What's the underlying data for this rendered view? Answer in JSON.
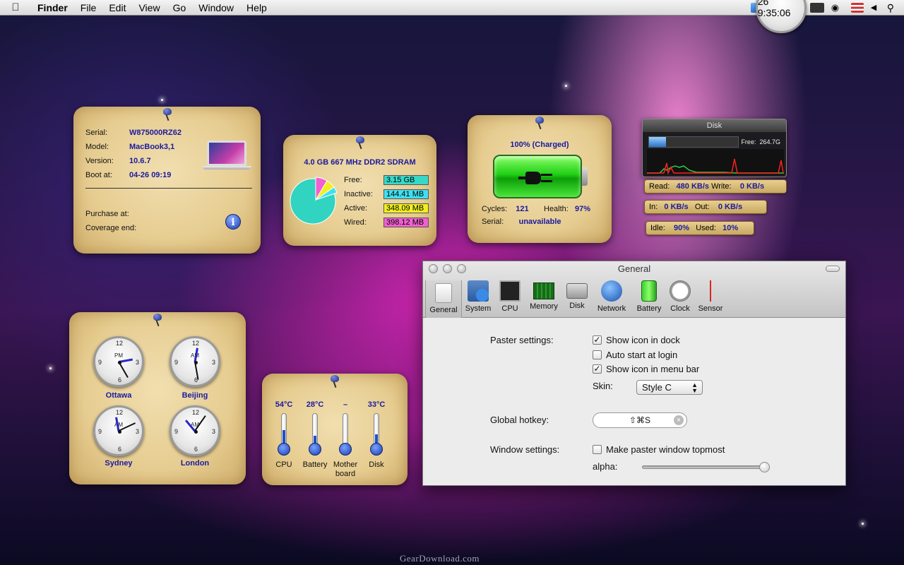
{
  "menubar": {
    "app_name": "Finder",
    "items": [
      "File",
      "Edit",
      "View",
      "Go",
      "Window",
      "Help"
    ],
    "clock": "Tue Apr 26  9:35:06"
  },
  "system_info": {
    "serial_label": "Serial:",
    "serial": "W875000RZ62",
    "model_label": "Model:",
    "model": "MacBook3,1",
    "version_label": "Version:",
    "version": "10.6.7",
    "boot_label": "Boot at:",
    "boot": "04-26 09:19",
    "purchase_label": "Purchase at:",
    "coverage_label": "Coverage end:"
  },
  "memory": {
    "title": "4.0 GB 667 MHz DDR2 SDRAM",
    "rows": [
      {
        "label": "Free:",
        "value": "3.15 GB",
        "color": "#38d8c8"
      },
      {
        "label": "Inactive:",
        "value": "144.41 MB",
        "color": "#40e0f0"
      },
      {
        "label": "Active:",
        "value": "348.09 MB",
        "color": "#f0f020"
      },
      {
        "label": "Wired:",
        "value": "398.12 MB",
        "color": "#f060d0"
      }
    ]
  },
  "battery": {
    "status": "100% (Charged)",
    "cycles_label": "Cycles:",
    "cycles": "121",
    "health_label": "Health:",
    "health": "97%",
    "serial_label": "Serial:",
    "serial": "unavailable",
    "level": 1.0
  },
  "disk": {
    "title": "Disk",
    "free_label": "Free:",
    "free": "264.7G",
    "read_label": "Read:",
    "read": "480 KB/s",
    "write_label": "Write:",
    "write": "0 KB/s",
    "in_label": "In:",
    "in": "0 KB/s",
    "out_label": "Out:",
    "out": "0 KB/s",
    "idle_label": "Idle:",
    "idle": "90%",
    "used_label": "Used:",
    "used": "10%"
  },
  "clocks": [
    {
      "name": "Ottawa",
      "ampm": "PM"
    },
    {
      "name": "Beijing",
      "ampm": "AM"
    },
    {
      "name": "Sydney",
      "ampm": "AM"
    },
    {
      "name": "London",
      "ampm": "AM"
    }
  ],
  "clock_numbers": {
    "n12": "12",
    "n3": "3",
    "n6": "6",
    "n9": "9"
  },
  "temperatures": [
    {
      "name": "CPU",
      "value": "54°C",
      "level": 0.6
    },
    {
      "name": "Battery",
      "value": "28°C",
      "level": 0.35
    },
    {
      "name": "Mother board",
      "value": "–",
      "level": 0.0
    },
    {
      "name": "Disk",
      "value": "33°C",
      "level": 0.42
    }
  ],
  "prefs": {
    "window_title": "General",
    "tabs": [
      "General",
      "System",
      "CPU",
      "Memory",
      "Disk",
      "Network",
      "Battery",
      "Clock",
      "Sensor"
    ],
    "paster_label": "Paster settings:",
    "show_dock": "Show icon in dock",
    "auto_start": "Auto start at login",
    "show_menubar": "Show icon in menu bar",
    "skin_label": "Skin:",
    "skin_value": "Style C",
    "hotkey_label": "Global hotkey:",
    "hotkey_value": "⇧⌘S",
    "window_label": "Window settings:",
    "topmost": "Make paster window topmost",
    "alpha_label": "alpha:",
    "alpha_value": 1.0
  },
  "watermark": "GearDownload.com"
}
